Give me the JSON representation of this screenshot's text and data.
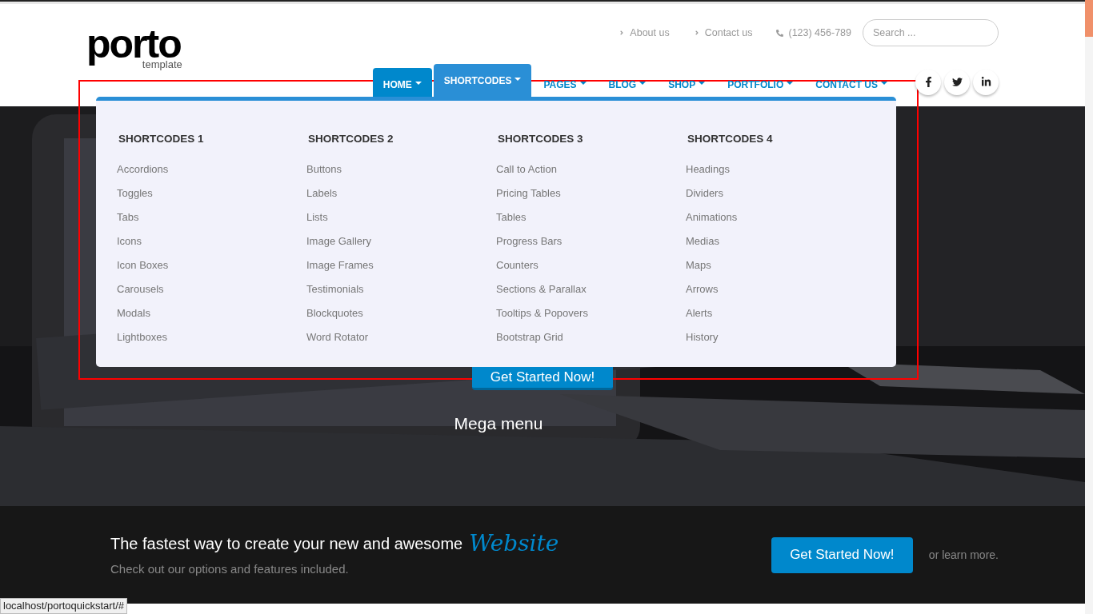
{
  "logo": {
    "name": "porto",
    "tagline": "template"
  },
  "top_links": [
    {
      "kind": "link",
      "label": "About us"
    },
    {
      "kind": "link",
      "label": "Contact us"
    },
    {
      "kind": "phone",
      "label": "(123) 456-789"
    }
  ],
  "search": {
    "placeholder": "Search ..."
  },
  "nav": [
    {
      "label": "HOME",
      "selected": true,
      "expanded": false
    },
    {
      "label": "SHORTCODES",
      "selected": false,
      "expanded": true
    },
    {
      "label": "PAGES",
      "selected": false,
      "expanded": false
    },
    {
      "label": "BLOG",
      "selected": false,
      "expanded": false
    },
    {
      "label": "SHOP",
      "selected": false,
      "expanded": false
    },
    {
      "label": "PORTFOLIO",
      "selected": false,
      "expanded": false
    },
    {
      "label": "CONTACT US",
      "selected": false,
      "expanded": false
    }
  ],
  "social": [
    {
      "kind": "facebook"
    },
    {
      "kind": "twitter"
    },
    {
      "kind": "linkedin"
    }
  ],
  "mega_menu": {
    "columns": [
      {
        "title": "SHORTCODES 1",
        "items": [
          "Accordions",
          "Toggles",
          "Tabs",
          "Icons",
          "Icon Boxes",
          "Carousels",
          "Modals",
          "Lightboxes"
        ]
      },
      {
        "title": "SHORTCODES 2",
        "items": [
          "Buttons",
          "Labels",
          "Lists",
          "Image Gallery",
          "Image Frames",
          "Testimonials",
          "Blockquotes",
          "Word Rotator"
        ]
      },
      {
        "title": "SHORTCODES 3",
        "items": [
          "Call to Action",
          "Pricing Tables",
          "Tables",
          "Progress Bars",
          "Counters",
          "Sections & Parallax",
          "Tooltips & Popovers",
          "Bootstrap Grid"
        ]
      },
      {
        "title": "SHORTCODES 4",
        "items": [
          "Headings",
          "Dividers",
          "Animations",
          "Medias",
          "Maps",
          "Arrows",
          "Alerts",
          "History"
        ]
      }
    ]
  },
  "hero": {
    "kind": "picture",
    "button": "Get Started Now!",
    "caption": "Mega menu"
  },
  "call_to_action": {
    "headline": "The fastest way to create your new and awesome",
    "highlight": "Website",
    "subline": "Check out our options and features included.",
    "button": "Get Started Now!",
    "aside": "or learn more."
  },
  "status_bar": {
    "url": "localhost/portoquickstart/#"
  }
}
